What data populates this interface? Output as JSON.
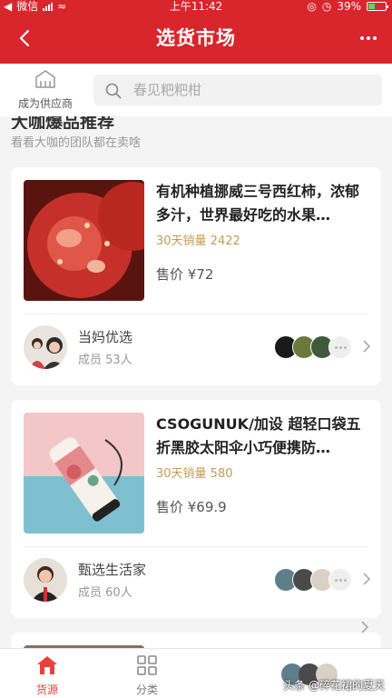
{
  "status": {
    "carrier": "微信",
    "time": "上午11:42",
    "battery": "39%"
  },
  "nav": {
    "title": "选货市场"
  },
  "search": {
    "supplier_label": "成为供应商",
    "placeholder": "春见粑粑柑"
  },
  "section": {
    "title": "大咖爆品推荐",
    "subtitle": "看看大咖的团队都在卖啥"
  },
  "products": [
    {
      "title": "有机种植挪威三号西红柿，浓郁多汁，世界最好吃的水果…",
      "sales": "30天销量 2422",
      "price": "售价 ¥72",
      "team_name": "当妈优选",
      "team_members": "成员 53人"
    },
    {
      "title": "CSOGUNUK/加设 超轻口袋五折黑胶太阳伞小巧便携防…",
      "sales": "30天销量 580",
      "price": "售价 ¥69.9",
      "team_name": "甄选生活家",
      "team_members": "成员 60人"
    }
  ],
  "tabs": {
    "source": "货源",
    "category": "分类"
  },
  "watermark": "头条 @碎花裙的夏天",
  "colors": {
    "brand": "#d8262c",
    "sales": "#c49a55",
    "tab_active": "#e8413a"
  }
}
